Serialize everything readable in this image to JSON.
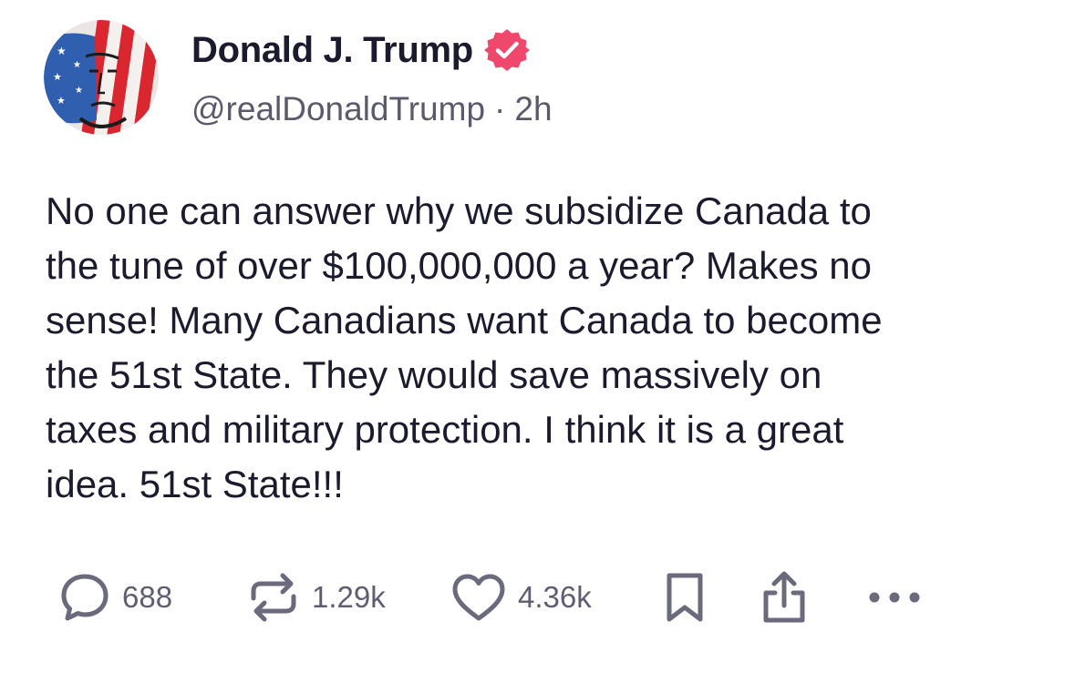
{
  "post": {
    "author": {
      "display_name": "Donald J. Trump",
      "handle": "@realDonaldTrump",
      "verified": true,
      "badge_color": "#f0486c"
    },
    "time_ago": "2h",
    "separator": "·",
    "text": "No one can answer why we subsidize Canada to\nthe tune of over $100,000,000 a year? Makes no\nsense! Many Canadians want Canada to become\nthe 51st State. They would save massively on\ntaxes and military protection. I think it is a great\nidea. 51st State!!!",
    "actions": {
      "replies": "688",
      "reposts": "1.29k",
      "likes": "4.36k"
    },
    "icons": {
      "reply": "speech-bubble-icon",
      "repost": "repost-arrows-icon",
      "like": "heart-icon",
      "bookmark": "bookmark-icon",
      "share": "share-icon",
      "more": "more-dots-icon"
    },
    "colors": {
      "text": "#1c1b2e",
      "muted": "#5b5a6b",
      "icon": "#6b6a7c"
    }
  }
}
